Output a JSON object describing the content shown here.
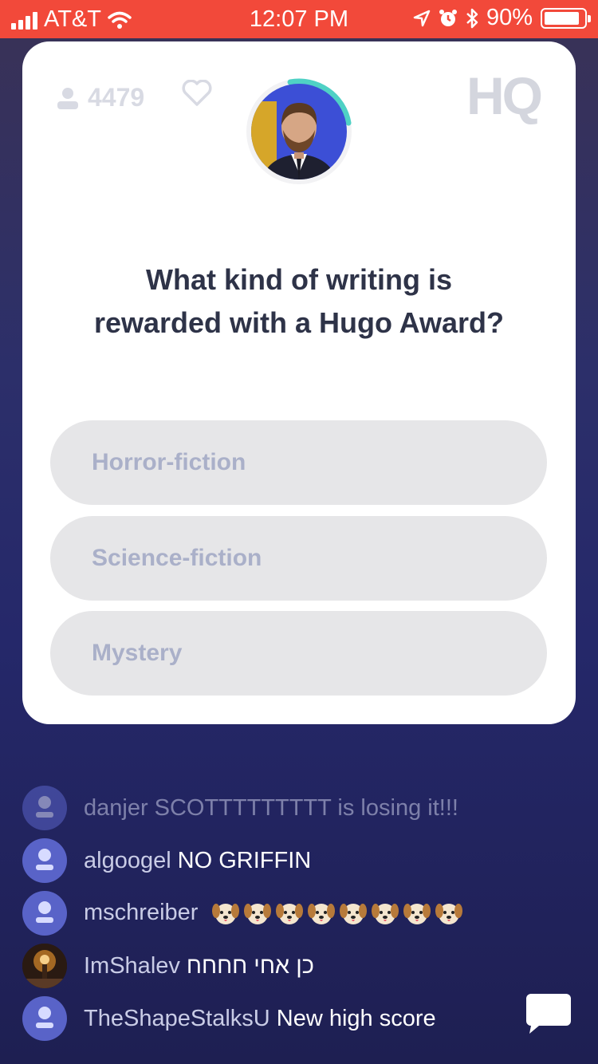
{
  "status_bar": {
    "carrier": "AT&T",
    "time": "12:07 PM",
    "battery_percent": "90%",
    "battery_level": 0.9,
    "bg_color": "#f2493a"
  },
  "card": {
    "viewer_count": "4479",
    "logo_text": "HQ",
    "host_timer_color": "#4fd1c5",
    "question_line1": "What kind of writing is",
    "question_line2": "rewarded with a Hugo Award?",
    "answers": [
      {
        "label": "Horror-fiction"
      },
      {
        "label": "Science-fiction"
      },
      {
        "label": "Mystery"
      }
    ]
  },
  "chat": {
    "messages": [
      {
        "user": "danjer",
        "text": "SCOTTTTTTTTT is losing it!!!",
        "faded": true
      },
      {
        "user": "algoogel",
        "text": "NO GRIFFIN"
      },
      {
        "user": "mschreiber",
        "emoji": "puppy-emoji",
        "emoji_count": 8
      },
      {
        "user": "ImShalev",
        "text": "כן אחי חחחח"
      },
      {
        "user": "TheShapeStalksU",
        "text": "New high score"
      }
    ]
  }
}
